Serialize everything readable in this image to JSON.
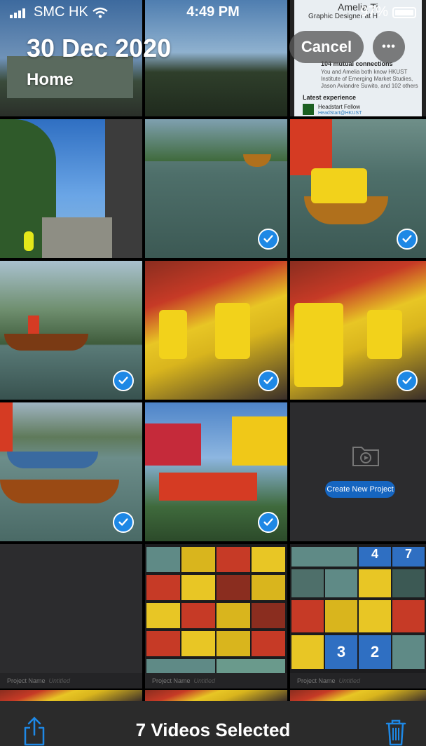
{
  "status": {
    "carrier": "SMC HK",
    "time": "4:49 PM",
    "battery": "97%"
  },
  "header": {
    "date": "30 Dec 2020",
    "location": "Home",
    "cancel_label": "Cancel",
    "more_label": "•••"
  },
  "linked_card": {
    "name": "Amelia Ti",
    "subtitle": "Graphic Designer at H",
    "mutual_count": "104 mutual connections",
    "mutual_desc": "You and Amelia both know HKUST Institute of Emerging Market Studies, Jason Aviandre Suwito, and 102 others",
    "experience_title": "Latest experience",
    "fellow": "Headstart Fellow",
    "fellow_org": "HeadStart@HKUST"
  },
  "project": {
    "button": "Create New Project",
    "name_label": "Project Name",
    "name_value": "Untitled"
  },
  "mosaic_numbers": {
    "a": "4",
    "b": "7",
    "c": "3",
    "d": "2"
  },
  "bottom_bar": {
    "title": "7 Videos Selected"
  },
  "colors": {
    "accent": "#1e88e5",
    "bar": "#2b2b2b"
  },
  "icons": {
    "share": "share-icon",
    "trash": "trash-icon",
    "check": "checkmark-icon",
    "folder": "folder-video-icon"
  }
}
